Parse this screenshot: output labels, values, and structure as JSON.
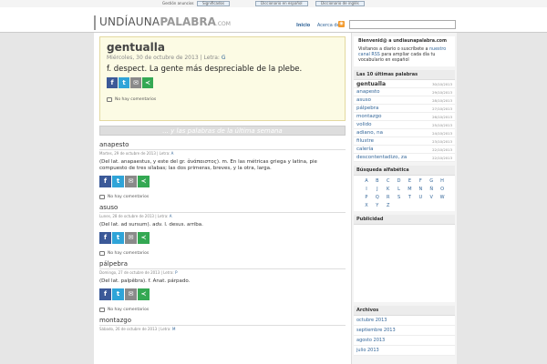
{
  "adstrip": {
    "label": "Gestión anuncios",
    "links": [
      "Significados",
      "Diccionario en español",
      "Diccionario de inglés"
    ]
  },
  "header": {
    "logo": {
      "part1": "UNDÍAUNA",
      "part2": "PALABRA",
      "part3": ".COM"
    },
    "nav": [
      {
        "label": "Inicio",
        "active": true
      },
      {
        "label": "Acerca de",
        "active": false
      }
    ],
    "rss_icon": "rss-icon",
    "search_value": ""
  },
  "featured": {
    "title": "gentualla",
    "meta_date": "Miércoles, 30 de octubre de 2013 | Letra:",
    "meta_letter": "G",
    "definition": "f. despect. La gente más despreciable de la plebe.",
    "comments": "No hay comentarios"
  },
  "week_banner": "... y las palabras de la última semana",
  "posts": [
    {
      "title": "anapesto",
      "meta_date": "Martes, 29 de octubre de 2013 | Letra:",
      "meta_letter": "A",
      "definition": "(Del lat. anapaestus, y este del gr. ἀνάπαιστος). m. En las métricas griega y latina, pie compuesto de tres sílabas; las dos primeras, breves, y la otra, larga.",
      "comments": "No hay comentarios"
    },
    {
      "title": "asuso",
      "meta_date": "Lunes, 28 de octubre de 2013 | Letra:",
      "meta_letter": "A",
      "definition": "(Del lat. ad sursum). adv. l. desus. arriba.",
      "comments": "No hay comentarios"
    },
    {
      "title": "pálpebra",
      "meta_date": "Domingo, 27 de octubre de 2013 | Letra:",
      "meta_letter": "P",
      "definition": "(Del lat. palpĕbra). f. Anat. párpado.",
      "comments": "No hay comentarios"
    },
    {
      "title": "montazgo",
      "meta_date": "Sábado, 26 de octubre de 2013 | Letra:",
      "meta_letter": "M",
      "definition": "",
      "comments": ""
    }
  ],
  "sidebar": {
    "welcome": {
      "title": "Bienvenid@ a undiaunapalabra.com",
      "text_before": "Visítanos a diario o suscríbete a",
      "link": "nuestro canal RSS",
      "text_after": "para ampliar cada día tu vocabulario en español"
    },
    "latest_head": "Las 10 últimas palabras",
    "latest": [
      {
        "word": "gentualla",
        "date": "30/10/2013"
      },
      {
        "word": "anapesto",
        "date": "29/10/2013"
      },
      {
        "word": "asuso",
        "date": "28/10/2013"
      },
      {
        "word": "pálpebra",
        "date": "27/10/2013"
      },
      {
        "word": "montazgo",
        "date": "26/10/2013"
      },
      {
        "word": "volido",
        "date": "25/10/2013"
      },
      {
        "word": "adiano, na",
        "date": "24/10/2013"
      },
      {
        "word": "filustre",
        "date": "23/10/2013"
      },
      {
        "word": "calería",
        "date": "22/10/2013"
      },
      {
        "word": "descontentadizo, za",
        "date": "22/10/2013"
      }
    ],
    "alpha_head": "Búsqueda alfabética",
    "alphabet": [
      "A",
      "B",
      "C",
      "D",
      "E",
      "F",
      "G",
      "H",
      "I",
      "J",
      "K",
      "L",
      "M",
      "N",
      "Ñ",
      "O",
      "P",
      "Q",
      "R",
      "S",
      "T",
      "U",
      "V",
      "W",
      "X",
      "Y",
      "Z"
    ],
    "ads_head": "Publicidad",
    "archives_head": "Archivos",
    "archives": [
      "octubre 2013",
      "septiembre 2013",
      "agosto 2013",
      "julio 2013"
    ]
  }
}
